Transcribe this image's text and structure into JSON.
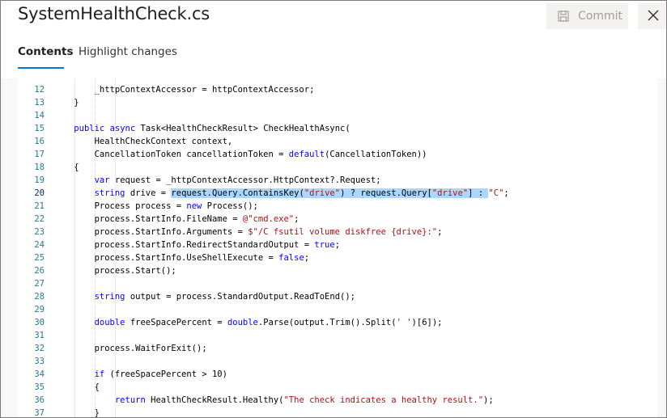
{
  "window": {
    "title": "SystemHealthCheck.cs"
  },
  "toolbar": {
    "commit_label": "Commit",
    "commit_icon": "save-icon",
    "close_icon": "close-icon"
  },
  "tabs": [
    {
      "label": "Contents",
      "active": true
    },
    {
      "label": "Highlight changes",
      "active": false
    }
  ],
  "colors": {
    "accent": "#0078d4",
    "keyword": "#0000ff",
    "string": "#a31515",
    "line_number": "#237893",
    "selection": "#add6ff"
  },
  "code": {
    "selected_line": "20",
    "lines": [
      {
        "n": "12",
        "segs": [
          {
            "t": "        _httpContextAccessor = httpContextAccessor;"
          }
        ]
      },
      {
        "n": "13",
        "segs": [
          {
            "t": "    }"
          }
        ]
      },
      {
        "n": "14",
        "segs": [
          {
            "t": ""
          }
        ]
      },
      {
        "n": "15",
        "segs": [
          {
            "t": "    "
          },
          {
            "t": "public",
            "c": "kw"
          },
          {
            "t": " "
          },
          {
            "t": "async",
            "c": "kw"
          },
          {
            "t": " Task<HealthCheckResult> CheckHealthAsync("
          }
        ]
      },
      {
        "n": "16",
        "segs": [
          {
            "t": "        HealthCheckContext context,"
          }
        ]
      },
      {
        "n": "17",
        "segs": [
          {
            "t": "        CancellationToken cancellationToken = "
          },
          {
            "t": "default",
            "c": "kw"
          },
          {
            "t": "(CancellationToken))"
          }
        ]
      },
      {
        "n": "18",
        "segs": [
          {
            "t": "    {"
          }
        ]
      },
      {
        "n": "19",
        "segs": [
          {
            "t": "        "
          },
          {
            "t": "var",
            "c": "kw"
          },
          {
            "t": " request = _httpContextAccessor.HttpContext?.Request;"
          }
        ]
      },
      {
        "n": "20",
        "segs": [
          {
            "t": "        "
          },
          {
            "t": "string",
            "c": "kw"
          },
          {
            "t": " drive = "
          },
          {
            "t": "request.Query.ContainsKey(",
            "c": "sel"
          },
          {
            "t": "\"drive\"",
            "c": "str sel"
          },
          {
            "t": ") ? request.Query[",
            "c": "sel"
          },
          {
            "t": "\"drive\"",
            "c": "str sel"
          },
          {
            "t": "] : ",
            "c": "sel"
          },
          {
            "t": "\"C\"",
            "c": "str"
          },
          {
            "t": ";"
          }
        ]
      },
      {
        "n": "21",
        "segs": [
          {
            "t": "        Process process = "
          },
          {
            "t": "new",
            "c": "kw"
          },
          {
            "t": " Process();"
          }
        ]
      },
      {
        "n": "22",
        "segs": [
          {
            "t": "        process.StartInfo.FileName = "
          },
          {
            "t": "@\"cmd.exe\"",
            "c": "str"
          },
          {
            "t": ";"
          }
        ]
      },
      {
        "n": "23",
        "segs": [
          {
            "t": "        process.StartInfo.Arguments = "
          },
          {
            "t": "$\"/C fsutil volume diskfree {drive}:\"",
            "c": "str"
          },
          {
            "t": ";"
          }
        ]
      },
      {
        "n": "24",
        "segs": [
          {
            "t": "        process.StartInfo.RedirectStandardOutput = "
          },
          {
            "t": "true",
            "c": "kw"
          },
          {
            "t": ";"
          }
        ]
      },
      {
        "n": "25",
        "segs": [
          {
            "t": "        process.StartInfo.UseShellExecute = "
          },
          {
            "t": "false",
            "c": "kw"
          },
          {
            "t": ";"
          }
        ]
      },
      {
        "n": "26",
        "segs": [
          {
            "t": "        process.Start();"
          }
        ]
      },
      {
        "n": "27",
        "segs": [
          {
            "t": ""
          }
        ]
      },
      {
        "n": "28",
        "segs": [
          {
            "t": "        "
          },
          {
            "t": "string",
            "c": "kw"
          },
          {
            "t": " output = process.StandardOutput.ReadToEnd();"
          }
        ]
      },
      {
        "n": "29",
        "segs": [
          {
            "t": ""
          }
        ]
      },
      {
        "n": "30",
        "segs": [
          {
            "t": "        "
          },
          {
            "t": "double",
            "c": "kw"
          },
          {
            "t": " freeSpacePercent = "
          },
          {
            "t": "double",
            "c": "kw"
          },
          {
            "t": ".Parse(output.Trim().Split("
          },
          {
            "t": "' '",
            "c": "str"
          },
          {
            "t": ")[6]);"
          }
        ]
      },
      {
        "n": "31",
        "segs": [
          {
            "t": ""
          }
        ]
      },
      {
        "n": "32",
        "segs": [
          {
            "t": "        process.WaitForExit();"
          }
        ]
      },
      {
        "n": "33",
        "segs": [
          {
            "t": ""
          }
        ]
      },
      {
        "n": "34",
        "segs": [
          {
            "t": "        "
          },
          {
            "t": "if",
            "c": "kw"
          },
          {
            "t": " (freeSpacePercent > 10)"
          }
        ]
      },
      {
        "n": "35",
        "segs": [
          {
            "t": "        {"
          }
        ]
      },
      {
        "n": "36",
        "segs": [
          {
            "t": "            "
          },
          {
            "t": "return",
            "c": "kw"
          },
          {
            "t": " HealthCheckResult.Healthy("
          },
          {
            "t": "\"The check indicates a healthy result.\"",
            "c": "str"
          },
          {
            "t": ");"
          }
        ]
      },
      {
        "n": "37",
        "segs": [
          {
            "t": "        }"
          }
        ]
      }
    ]
  }
}
